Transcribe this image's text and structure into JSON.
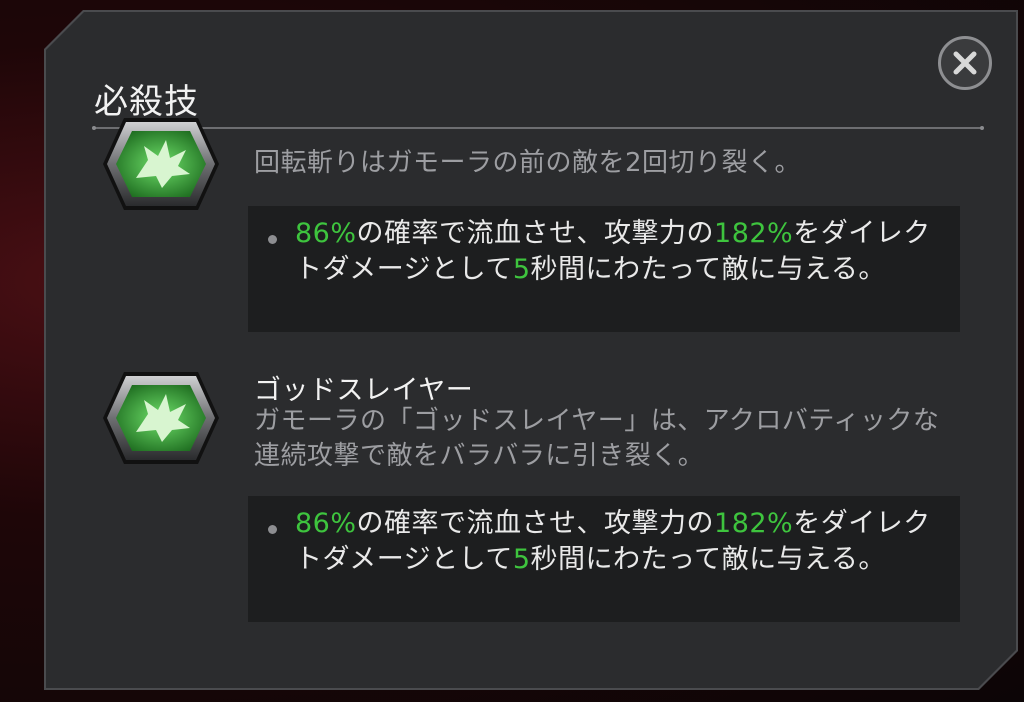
{
  "dialog": {
    "title": "必殺技",
    "close_icon": "close-x-icon"
  },
  "skills": [
    {
      "icon": "green-burst-hex-icon",
      "description": "回転斬りはガモーラの前の敵を2回切り裂く。",
      "effect": {
        "chance": "86%",
        "part1": "の確率で流血させ、攻撃力の",
        "attack_pct": "182%",
        "part2": "をダイレクトダメージとして",
        "duration": "5",
        "part3": "秒間にわたって敵に与える。"
      }
    },
    {
      "icon": "green-burst-hex-icon",
      "name": "ゴッドスレイヤー",
      "description": "ガモーラの「ゴッドスレイヤー」は、アクロバティックな連続攻撃で敵をバラバラに引き裂く。",
      "effect": {
        "chance": "86%",
        "part1": "の確率で流血させ、攻撃力の",
        "attack_pct": "182%",
        "part2": "をダイレクトダメージとして",
        "duration": "5",
        "part3": "秒間にわたって敵に与える。"
      }
    }
  ],
  "colors": {
    "highlight": "#3ec43e",
    "panel": "#2b2c2e",
    "effect_box": "#1d1e1f"
  }
}
